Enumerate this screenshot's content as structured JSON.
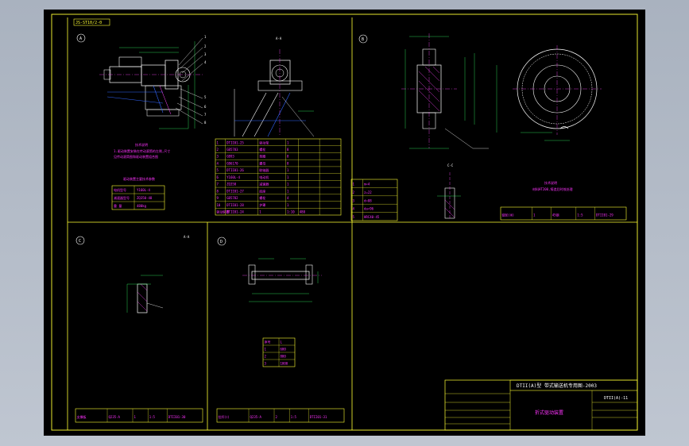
{
  "sheet": {
    "tag_top_left": "JS-ST10/2-0",
    "section_labels": [
      "A",
      "B",
      "C",
      "D"
    ],
    "view_a_mark": "A-A",
    "view_b_cut": "C-C",
    "view_c_mark": "A-A",
    "drawing_code": "DTII(A)-11",
    "drawing_title": "DTII(A)型 带式输送机专用图-2003",
    "part_name": "折式驱动装置"
  },
  "colors": {
    "frame": "#ffff33",
    "geometry": "#ffffff",
    "dimension": "#33ff66",
    "centerline": "#ff44ff",
    "hidden": "#3366ff",
    "text": "#ff33ff"
  },
  "notes": {
    "tech_req_title": "技术说明",
    "tech_req_lines": [
      "1.驱动装置安装在传动滚筒的左侧,尺寸",
      "见传动滚筒图和驱动装置组合图"
    ],
    "param_table_title": "驱动装置主要技术参数",
    "tech_req_b_title": "技术说明",
    "tech_req_b_line": "材料HT200,铸造后时效处理"
  },
  "tables": {
    "param_a": {
      "rows": [
        [
          "电机型号",
          "Y160L-4"
        ],
        [
          "减速器型号",
          "ZQ350-48"
        ],
        [
          "重 量",
          "480kg"
        ]
      ]
    },
    "bom_a": {
      "rows": [
        [
          "1",
          "DTII01-25",
          "驱动架",
          "1",
          "",
          ""
        ],
        [
          "2",
          "GB5783",
          "螺栓",
          "8",
          "",
          ""
        ],
        [
          "3",
          "GB93",
          "垫圈",
          "8",
          "",
          ""
        ],
        [
          "4",
          "GB6170",
          "螺母",
          "8",
          "",
          ""
        ],
        [
          "5",
          "DTII01-26",
          "联轴器",
          "1",
          "",
          ""
        ],
        [
          "6",
          "Y160L-4",
          "电动机",
          "1",
          "",
          ""
        ],
        [
          "7",
          "ZQ350",
          "减速器",
          "1",
          "",
          ""
        ],
        [
          "8",
          "DTII01-27",
          "底座",
          "1",
          "",
          ""
        ],
        [
          "9",
          "GB5782",
          "螺栓",
          "4",
          "",
          ""
        ],
        [
          "10",
          "DTII01-28",
          "护罩",
          "1",
          "",
          ""
        ]
      ],
      "footer": [
        "驱动装置",
        "DTII01-24",
        "1",
        "1:10",
        "480"
      ]
    },
    "bom_b": {
      "rows": [
        [
          "1",
          "m=4"
        ],
        [
          "2",
          "z=22"
        ],
        [
          "3",
          "d=88"
        ],
        [
          "4",
          "da=96"
        ],
        [
          "5",
          "HRC40-45"
        ]
      ]
    },
    "title_b": [
      "链轮(Ⅲ)",
      "1",
      "45钢",
      "1:5",
      "DTII01-29"
    ],
    "table_d": {
      "rows": [
        [
          "序号",
          "L"
        ],
        [
          "1",
          "600"
        ],
        [
          "2",
          "800"
        ],
        [
          "3",
          "1000"
        ]
      ]
    },
    "title_c": [
      "支撑板",
      "Q235-A",
      "1",
      "1:5",
      "DTII01-30"
    ],
    "title_d": [
      "拉杆(Ⅰ)",
      "Q235-A",
      "2",
      "1:5",
      "DTII01-31"
    ]
  }
}
